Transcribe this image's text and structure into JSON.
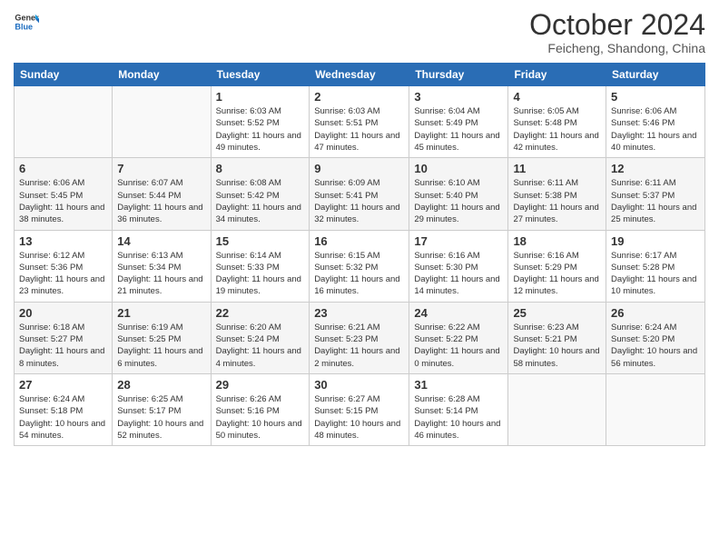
{
  "header": {
    "logo_general": "General",
    "logo_blue": "Blue",
    "month": "October 2024",
    "location": "Feicheng, Shandong, China"
  },
  "weekdays": [
    "Sunday",
    "Monday",
    "Tuesday",
    "Wednesday",
    "Thursday",
    "Friday",
    "Saturday"
  ],
  "rows": [
    [
      {
        "day": "",
        "info": ""
      },
      {
        "day": "",
        "info": ""
      },
      {
        "day": "1",
        "info": "Sunrise: 6:03 AM\nSunset: 5:52 PM\nDaylight: 11 hours and 49 minutes."
      },
      {
        "day": "2",
        "info": "Sunrise: 6:03 AM\nSunset: 5:51 PM\nDaylight: 11 hours and 47 minutes."
      },
      {
        "day": "3",
        "info": "Sunrise: 6:04 AM\nSunset: 5:49 PM\nDaylight: 11 hours and 45 minutes."
      },
      {
        "day": "4",
        "info": "Sunrise: 6:05 AM\nSunset: 5:48 PM\nDaylight: 11 hours and 42 minutes."
      },
      {
        "day": "5",
        "info": "Sunrise: 6:06 AM\nSunset: 5:46 PM\nDaylight: 11 hours and 40 minutes."
      }
    ],
    [
      {
        "day": "6",
        "info": "Sunrise: 6:06 AM\nSunset: 5:45 PM\nDaylight: 11 hours and 38 minutes."
      },
      {
        "day": "7",
        "info": "Sunrise: 6:07 AM\nSunset: 5:44 PM\nDaylight: 11 hours and 36 minutes."
      },
      {
        "day": "8",
        "info": "Sunrise: 6:08 AM\nSunset: 5:42 PM\nDaylight: 11 hours and 34 minutes."
      },
      {
        "day": "9",
        "info": "Sunrise: 6:09 AM\nSunset: 5:41 PM\nDaylight: 11 hours and 32 minutes."
      },
      {
        "day": "10",
        "info": "Sunrise: 6:10 AM\nSunset: 5:40 PM\nDaylight: 11 hours and 29 minutes."
      },
      {
        "day": "11",
        "info": "Sunrise: 6:11 AM\nSunset: 5:38 PM\nDaylight: 11 hours and 27 minutes."
      },
      {
        "day": "12",
        "info": "Sunrise: 6:11 AM\nSunset: 5:37 PM\nDaylight: 11 hours and 25 minutes."
      }
    ],
    [
      {
        "day": "13",
        "info": "Sunrise: 6:12 AM\nSunset: 5:36 PM\nDaylight: 11 hours and 23 minutes."
      },
      {
        "day": "14",
        "info": "Sunrise: 6:13 AM\nSunset: 5:34 PM\nDaylight: 11 hours and 21 minutes."
      },
      {
        "day": "15",
        "info": "Sunrise: 6:14 AM\nSunset: 5:33 PM\nDaylight: 11 hours and 19 minutes."
      },
      {
        "day": "16",
        "info": "Sunrise: 6:15 AM\nSunset: 5:32 PM\nDaylight: 11 hours and 16 minutes."
      },
      {
        "day": "17",
        "info": "Sunrise: 6:16 AM\nSunset: 5:30 PM\nDaylight: 11 hours and 14 minutes."
      },
      {
        "day": "18",
        "info": "Sunrise: 6:16 AM\nSunset: 5:29 PM\nDaylight: 11 hours and 12 minutes."
      },
      {
        "day": "19",
        "info": "Sunrise: 6:17 AM\nSunset: 5:28 PM\nDaylight: 11 hours and 10 minutes."
      }
    ],
    [
      {
        "day": "20",
        "info": "Sunrise: 6:18 AM\nSunset: 5:27 PM\nDaylight: 11 hours and 8 minutes."
      },
      {
        "day": "21",
        "info": "Sunrise: 6:19 AM\nSunset: 5:25 PM\nDaylight: 11 hours and 6 minutes."
      },
      {
        "day": "22",
        "info": "Sunrise: 6:20 AM\nSunset: 5:24 PM\nDaylight: 11 hours and 4 minutes."
      },
      {
        "day": "23",
        "info": "Sunrise: 6:21 AM\nSunset: 5:23 PM\nDaylight: 11 hours and 2 minutes."
      },
      {
        "day": "24",
        "info": "Sunrise: 6:22 AM\nSunset: 5:22 PM\nDaylight: 11 hours and 0 minutes."
      },
      {
        "day": "25",
        "info": "Sunrise: 6:23 AM\nSunset: 5:21 PM\nDaylight: 10 hours and 58 minutes."
      },
      {
        "day": "26",
        "info": "Sunrise: 6:24 AM\nSunset: 5:20 PM\nDaylight: 10 hours and 56 minutes."
      }
    ],
    [
      {
        "day": "27",
        "info": "Sunrise: 6:24 AM\nSunset: 5:18 PM\nDaylight: 10 hours and 54 minutes."
      },
      {
        "day": "28",
        "info": "Sunrise: 6:25 AM\nSunset: 5:17 PM\nDaylight: 10 hours and 52 minutes."
      },
      {
        "day": "29",
        "info": "Sunrise: 6:26 AM\nSunset: 5:16 PM\nDaylight: 10 hours and 50 minutes."
      },
      {
        "day": "30",
        "info": "Sunrise: 6:27 AM\nSunset: 5:15 PM\nDaylight: 10 hours and 48 minutes."
      },
      {
        "day": "31",
        "info": "Sunrise: 6:28 AM\nSunset: 5:14 PM\nDaylight: 10 hours and 46 minutes."
      },
      {
        "day": "",
        "info": ""
      },
      {
        "day": "",
        "info": ""
      }
    ]
  ]
}
